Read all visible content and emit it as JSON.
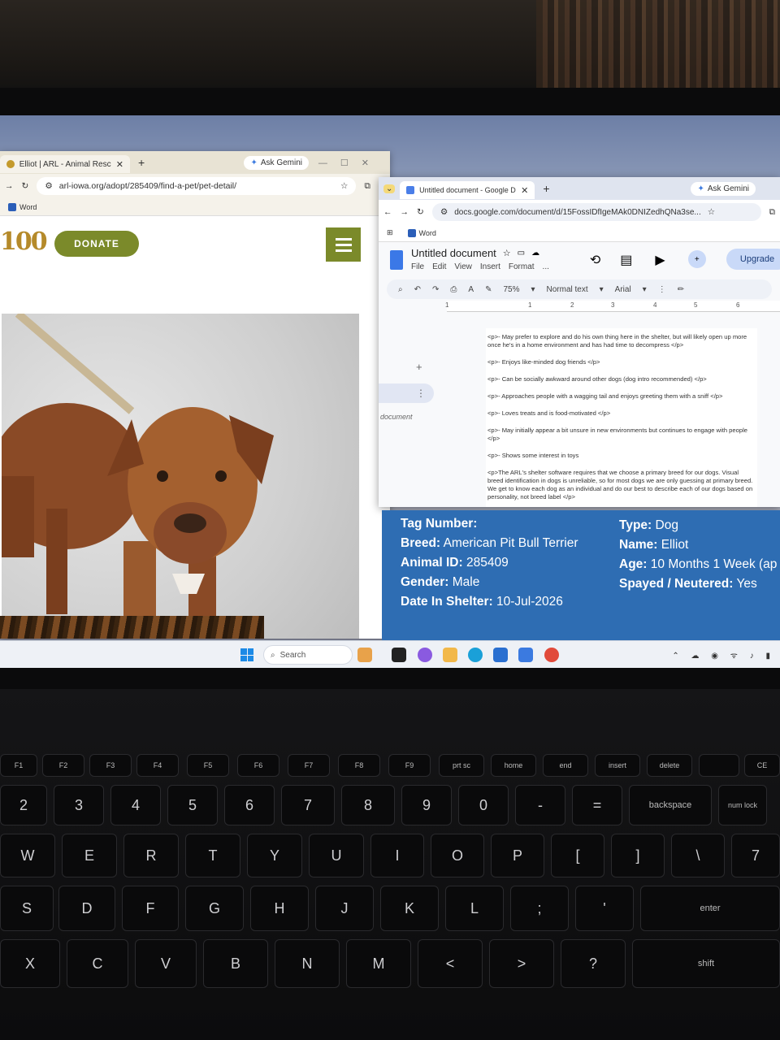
{
  "left_browser": {
    "tab_title": "Elliot | ARL - Animal Rescue Lea",
    "new_tab": "+",
    "gemini": "Ask Gemini",
    "url": "arl-iowa.org/adopt/285409/find-a-pet/pet-detail/",
    "bookmark": "Word",
    "site": {
      "logo_text": "100",
      "donate_label": "DONATE"
    }
  },
  "right_browser": {
    "tab_title": "Untitled document - Google Do",
    "new_tab": "+",
    "gemini": "Ask Gemini",
    "url": "docs.google.com/document/d/15FossIDfIgeMAk0DNIZedhQNa3se...",
    "bookmark": "Word",
    "doc": {
      "title": "Untitled document",
      "menus": [
        "File",
        "Edit",
        "View",
        "Insert",
        "Format",
        "..."
      ],
      "upgrade_label": "Upgrade",
      "zoom": "75%",
      "style": "Normal text",
      "font": "Arial",
      "ruler_marks": [
        "1",
        "1",
        "2",
        "3",
        "4",
        "5",
        "6"
      ],
      "outline_label": "document",
      "paragraphs": [
        "<p>- May prefer to explore and do his own thing here in the shelter, but will likely open up more once he's in a home environment and has had time to decompress </p>",
        "<p>- Enjoys like-minded dog friends </p>",
        "<p>- Can be socially awkward around other dogs (dog intro recommended) </p>",
        "<p>- Approaches people with a wagging tail and enjoys greeting them with a sniff </p>",
        "<p>- Loves treats and is food-motivated </p>",
        "<p>- May initially appear a bit unsure in new environments but continues to engage with people </p>",
        "<p>- Shows some interest in toys",
        "<p>The ARL's shelter software requires that we choose a primary breed for our dogs. Visual breed identification in dogs is unreliable, so for most dogs we are only guessing at primary breed. We get to know each dog as an individual and do our best to describe each of our dogs based on personality, not breed label </p>"
      ]
    }
  },
  "pet_info": {
    "tag_label": "Tag Number:",
    "tag_value": "",
    "breed_label": "Breed:",
    "breed_value": "American Pit Bull Terrier",
    "id_label": "Animal ID:",
    "id_value": "285409",
    "gender_label": "Gender:",
    "gender_value": "Male",
    "date_label": "Date In Shelter:",
    "date_value": "10-Jul-2026",
    "type_label": "Type:",
    "type_value": "Dog",
    "name_label": "Name:",
    "name_value": "Elliot",
    "age_label": "Age:",
    "age_value": "10 Months 1 Week (ap",
    "spayed_label": "Spayed / Neutered:",
    "spayed_value": "Yes"
  },
  "taskbar": {
    "search_placeholder": "Search"
  },
  "keyboard": {
    "row_fn": [
      "F1",
      "F2",
      "F3",
      "F4",
      "F5",
      "F6",
      "F7",
      "F8",
      "F9",
      "prt sc",
      "home",
      "end",
      "insert",
      "delete",
      "",
      "CE"
    ],
    "row_num": [
      "2",
      "3",
      "4",
      "5",
      "6",
      "7",
      "8",
      "9",
      "0",
      "-",
      "=",
      "backspace",
      "num lock"
    ],
    "row_q": [
      "W",
      "E",
      "R",
      "T",
      "Y",
      "U",
      "I",
      "O",
      "P",
      "[",
      "]",
      "\\",
      "7"
    ],
    "row_a": [
      "S",
      "D",
      "F",
      "G",
      "H",
      "J",
      "K",
      "L",
      ";",
      "'",
      "enter"
    ],
    "row_z": [
      "X",
      "C",
      "V",
      "B",
      "N",
      "M",
      "<",
      ">",
      "?",
      "shift"
    ]
  },
  "colors": {
    "donate_green": "#7b8a2a",
    "info_blue": "#2e6db3",
    "docs_blue": "#3b78e7"
  }
}
